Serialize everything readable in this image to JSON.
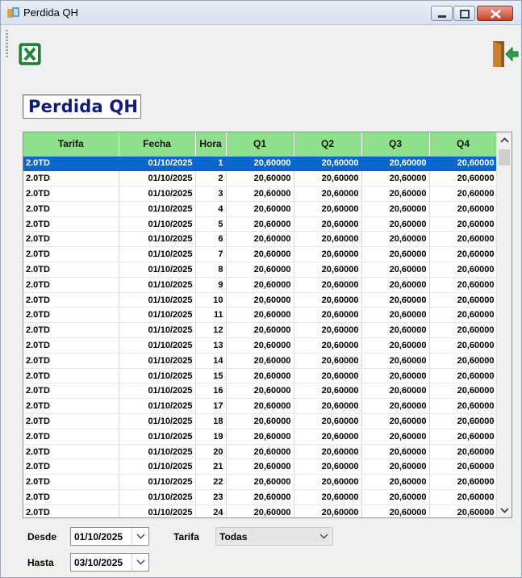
{
  "window": {
    "title": "Perdida QH"
  },
  "toolbar": {
    "export_excel": "excel-icon",
    "exit": "exit-door-icon"
  },
  "heading": "Perdida QH",
  "grid": {
    "columns": [
      "Tarifa",
      "Fecha",
      "Hora",
      "Q1",
      "Q2",
      "Q3",
      "Q4"
    ],
    "selected_row": 0,
    "rows": [
      [
        "2.0TD",
        "01/10/2025",
        "1",
        "20,60000",
        "20,60000",
        "20,60000",
        "20,60000"
      ],
      [
        "2.0TD",
        "01/10/2025",
        "2",
        "20,60000",
        "20,60000",
        "20,60000",
        "20,60000"
      ],
      [
        "2.0TD",
        "01/10/2025",
        "3",
        "20,60000",
        "20,60000",
        "20,60000",
        "20,60000"
      ],
      [
        "2.0TD",
        "01/10/2025",
        "4",
        "20,60000",
        "20,60000",
        "20,60000",
        "20,60000"
      ],
      [
        "2.0TD",
        "01/10/2025",
        "5",
        "20,60000",
        "20,60000",
        "20,60000",
        "20,60000"
      ],
      [
        "2.0TD",
        "01/10/2025",
        "6",
        "20,60000",
        "20,60000",
        "20,60000",
        "20,60000"
      ],
      [
        "2.0TD",
        "01/10/2025",
        "7",
        "20,60000",
        "20,60000",
        "20,60000",
        "20,60000"
      ],
      [
        "2.0TD",
        "01/10/2025",
        "8",
        "20,60000",
        "20,60000",
        "20,60000",
        "20,60000"
      ],
      [
        "2.0TD",
        "01/10/2025",
        "9",
        "20,60000",
        "20,60000",
        "20,60000",
        "20,60000"
      ],
      [
        "2.0TD",
        "01/10/2025",
        "10",
        "20,60000",
        "20,60000",
        "20,60000",
        "20,60000"
      ],
      [
        "2.0TD",
        "01/10/2025",
        "11",
        "20,60000",
        "20,60000",
        "20,60000",
        "20,60000"
      ],
      [
        "2.0TD",
        "01/10/2025",
        "12",
        "20,60000",
        "20,60000",
        "20,60000",
        "20,60000"
      ],
      [
        "2.0TD",
        "01/10/2025",
        "13",
        "20,60000",
        "20,60000",
        "20,60000",
        "20,60000"
      ],
      [
        "2.0TD",
        "01/10/2025",
        "14",
        "20,60000",
        "20,60000",
        "20,60000",
        "20,60000"
      ],
      [
        "2.0TD",
        "01/10/2025",
        "15",
        "20,60000",
        "20,60000",
        "20,60000",
        "20,60000"
      ],
      [
        "2.0TD",
        "01/10/2025",
        "16",
        "20,60000",
        "20,60000",
        "20,60000",
        "20,60000"
      ],
      [
        "2.0TD",
        "01/10/2025",
        "17",
        "20,60000",
        "20,60000",
        "20,60000",
        "20,60000"
      ],
      [
        "2.0TD",
        "01/10/2025",
        "18",
        "20,60000",
        "20,60000",
        "20,60000",
        "20,60000"
      ],
      [
        "2.0TD",
        "01/10/2025",
        "19",
        "20,60000",
        "20,60000",
        "20,60000",
        "20,60000"
      ],
      [
        "2.0TD",
        "01/10/2025",
        "20",
        "20,60000",
        "20,60000",
        "20,60000",
        "20,60000"
      ],
      [
        "2.0TD",
        "01/10/2025",
        "21",
        "20,60000",
        "20,60000",
        "20,60000",
        "20,60000"
      ],
      [
        "2.0TD",
        "01/10/2025",
        "22",
        "20,60000",
        "20,60000",
        "20,60000",
        "20,60000"
      ],
      [
        "2.0TD",
        "01/10/2025",
        "23",
        "20,60000",
        "20,60000",
        "20,60000",
        "20,60000"
      ],
      [
        "2.0TD",
        "01/10/2025",
        "24",
        "20,60000",
        "20,60000",
        "20,60000",
        "20,60000"
      ]
    ]
  },
  "filters": {
    "desde_label": "Desde",
    "desde_value": "01/10/2025",
    "hasta_label": "Hasta",
    "hasta_value": "03/10/2025",
    "tarifa_label": "Tarifa",
    "tarifa_value": "Todas"
  },
  "colors": {
    "header_green": "#8fe08c",
    "selection_blue": "#0a66cf",
    "heading_navy": "#111a7a"
  }
}
